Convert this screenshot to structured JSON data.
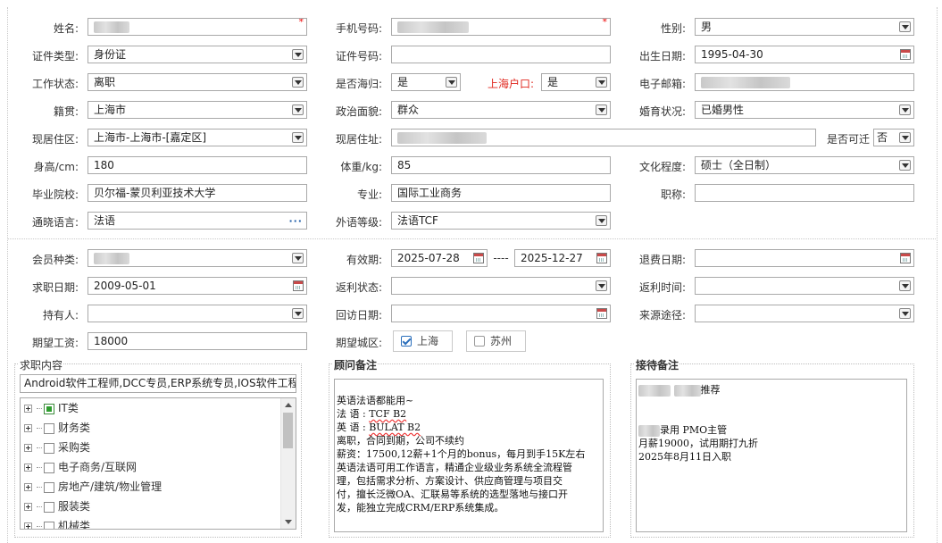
{
  "colors": {
    "required": "#e00000",
    "highlight_label": "#e0271e",
    "border": "#a9a9a9",
    "tree_checked": "#2f9e2f"
  },
  "basic": {
    "name": {
      "label": "姓名:",
      "value": ""
    },
    "phone": {
      "label": "手机号码:",
      "value": ""
    },
    "gender": {
      "label": "性别:",
      "value": "男"
    },
    "id_type": {
      "label": "证件类型:",
      "value": "身份证"
    },
    "id_no": {
      "label": "证件号码:",
      "value": ""
    },
    "birth": {
      "label": "出生日期:",
      "value": "1995-04-30"
    },
    "work_status": {
      "label": "工作状态:",
      "value": "离职"
    },
    "returnee": {
      "label": "是否海归:",
      "value": "是"
    },
    "sh_hukou": {
      "label": "上海户口:",
      "value": "是"
    },
    "email": {
      "label": "电子邮箱:",
      "value": ""
    },
    "native": {
      "label": "籍贯:",
      "value": "上海市"
    },
    "political": {
      "label": "政治面貌:",
      "value": "群众"
    },
    "marital": {
      "label": "婚育状况:",
      "value": "已婚男性"
    },
    "residence": {
      "label": "现居住区:",
      "value": "上海市-上海市-[嘉定区]"
    },
    "address": {
      "label": "现居住址:",
      "value": ""
    },
    "contactable": {
      "label": "是否可迁",
      "value": "否"
    },
    "height": {
      "label": "身高/cm:",
      "value": "180"
    },
    "weight": {
      "label": "体重/kg:",
      "value": "85"
    },
    "education": {
      "label": "文化程度:",
      "value": "硕士（全日制）"
    },
    "school": {
      "label": "毕业院校:",
      "value": "贝尔福-蒙贝利亚技术大学"
    },
    "major": {
      "label": "专业:",
      "value": "国际工业商务"
    },
    "title": {
      "label": "职称:",
      "value": ""
    },
    "language": {
      "label": "通晓语言:",
      "value": "法语"
    },
    "lang_level": {
      "label": "外语等级:",
      "value": "法语TCF"
    }
  },
  "member": {
    "type": {
      "label": "会员种类:",
      "value": ""
    },
    "valid": {
      "label": "有效期:",
      "from": "2025-07-28",
      "sep": "----",
      "to": "2025-12-27"
    },
    "refund_date": {
      "label": "退费日期:",
      "value": ""
    },
    "job_date": {
      "label": "求职日期:",
      "value": "2009-05-01"
    },
    "rebate_status": {
      "label": "返利状态:",
      "value": ""
    },
    "rebate_time": {
      "label": "返利时间:",
      "value": ""
    },
    "holder": {
      "label": "持有人:",
      "value": ""
    },
    "visit_date": {
      "label": "回访日期:",
      "value": ""
    },
    "source": {
      "label": "来源途径:",
      "value": ""
    },
    "salary": {
      "label": "期望工资:",
      "value": "18000"
    },
    "region": {
      "label": "期望城区:",
      "options": [
        {
          "label": "上海",
          "checked": true
        },
        {
          "label": "苏州",
          "checked": false
        }
      ]
    }
  },
  "job": {
    "title": "求职内容",
    "summary": "Android软件工程师,DCC专员,ERP系统专员,IOS软件工程",
    "tree": [
      {
        "label": "IT类",
        "checked": true
      },
      {
        "label": "财务类",
        "checked": false
      },
      {
        "label": "采购类",
        "checked": false
      },
      {
        "label": "电子商务/互联网",
        "checked": false
      },
      {
        "label": "房地产/建筑/物业管理",
        "checked": false
      },
      {
        "label": "服装类",
        "checked": false
      },
      {
        "label": "机械类",
        "checked": false
      }
    ]
  },
  "consultant": {
    "title": "顾问备注",
    "lines": [
      "英语法语都能用~",
      "法 语 : TCF B2",
      "英 语 : BULAT B2",
      "离职，合同到期，公司不续约",
      "薪资：17500,12薪+1个月的bonus，每月到手15K左右",
      "英语法语可用工作语言，精通企业级业务系统全流程管",
      "理，包括需求分析、方案设计、供应商管理与项目交",
      "付，擅长泛微OA、汇联易等系统的选型落地与接口开",
      "发，能独立完成CRM/ERP系统集成。"
    ]
  },
  "reception": {
    "title": "接待备注",
    "line1_suffix": "推荐",
    "line2_suffix": "录用 PMO主管",
    "line3": "月薪19000，试用期打九折",
    "line4": "2025年8月11日入职"
  }
}
